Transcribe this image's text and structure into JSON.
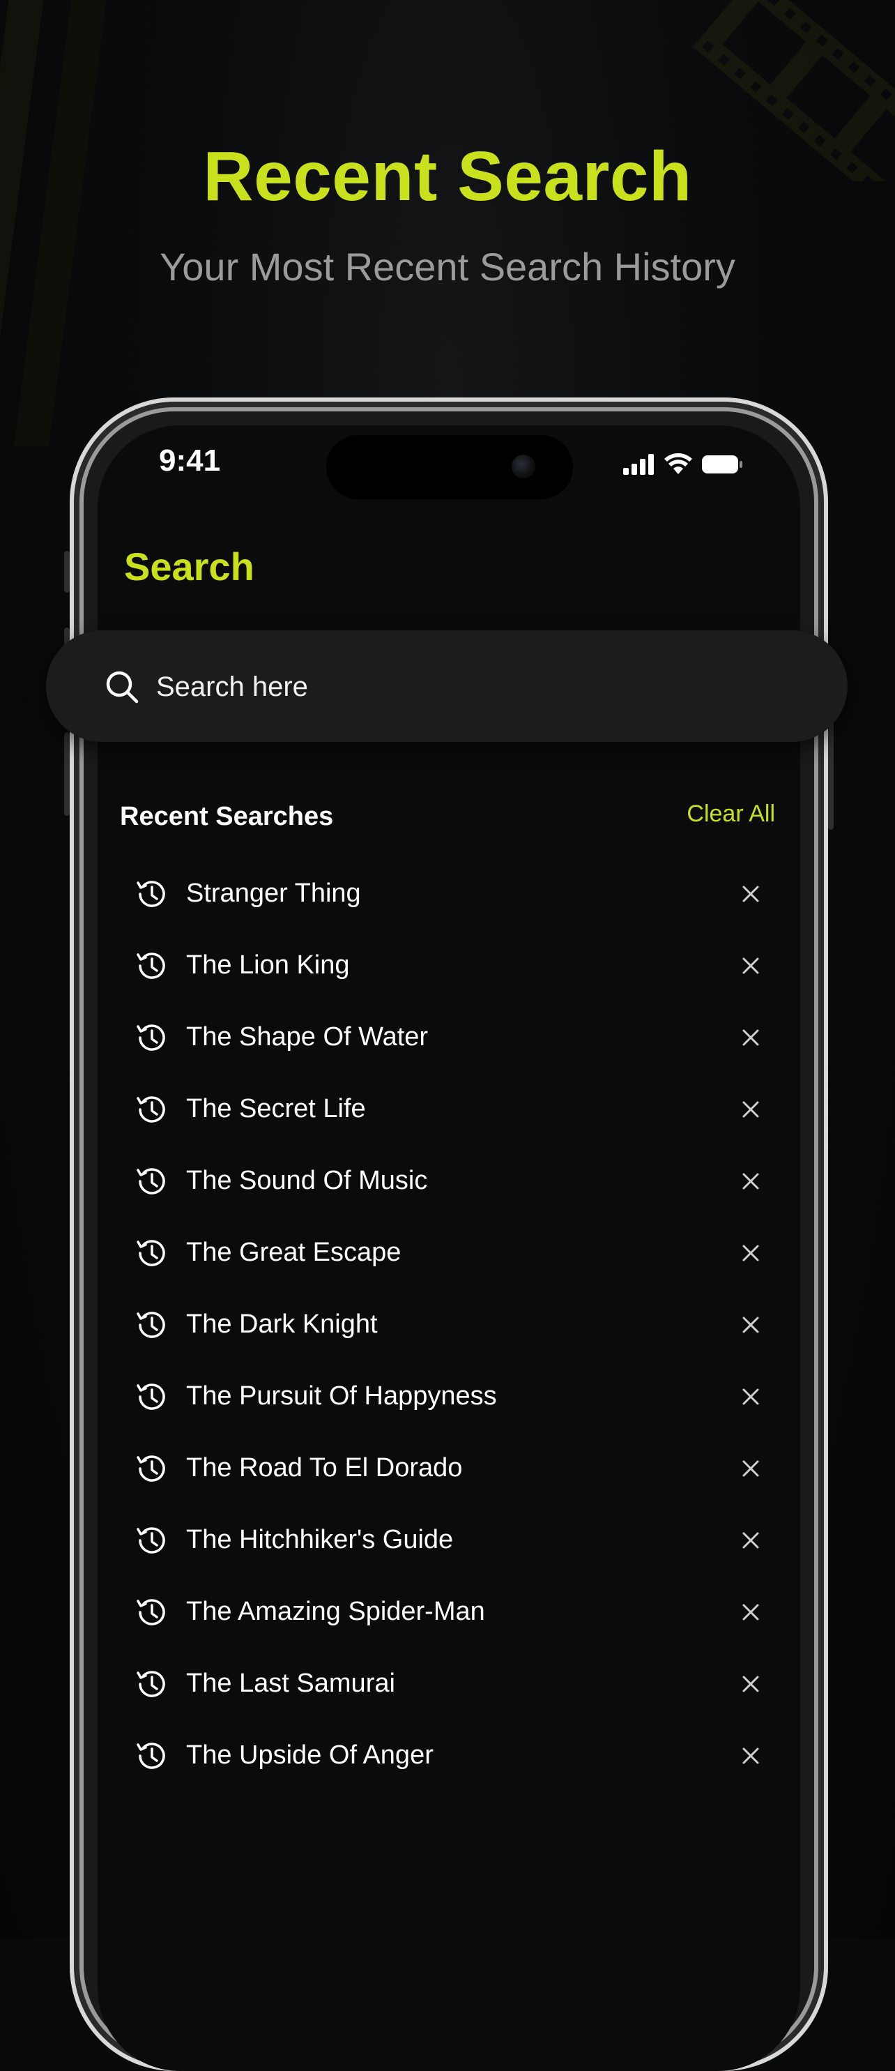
{
  "hero": {
    "title": "Recent Search",
    "subtitle": "Your Most Recent Search History"
  },
  "status_bar": {
    "time": "9:41",
    "icons": [
      "signal-icon",
      "wifi-icon",
      "battery-icon"
    ]
  },
  "screen": {
    "title": "Search",
    "search": {
      "placeholder": "Search here",
      "value": ""
    }
  },
  "recent": {
    "heading": "Recent Searches",
    "clear_label": "Clear All",
    "items": [
      "Stranger Thing",
      "The Lion King",
      "The Shape Of Water",
      "The Secret Life",
      "The Sound Of Music",
      "The Great Escape",
      "The Dark Knight",
      "The Pursuit Of Happyness",
      "The Road To El Dorado",
      "The Hitchhiker's Guide",
      "The Amazing Spider-Man",
      "The Last Samurai",
      "The Upside Of Anger"
    ]
  },
  "colors": {
    "accent": "#c9e01c",
    "background": "#0b0b0b",
    "search_bg": "#1c1c1c",
    "subtitle": "#9a9b9d"
  }
}
